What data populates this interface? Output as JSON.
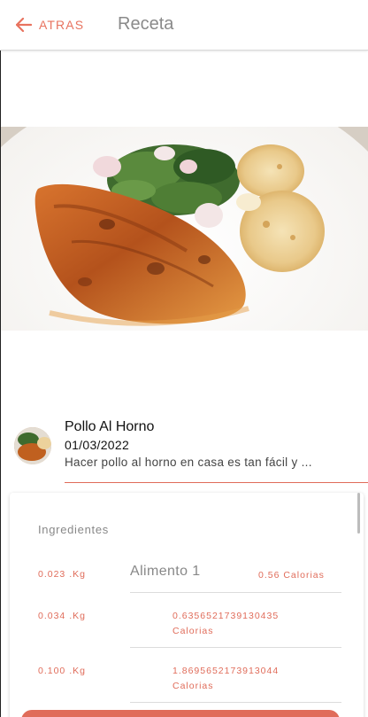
{
  "header": {
    "back_label": "ATRAS",
    "title": "Receta"
  },
  "recipe": {
    "name": "Pollo Al Horno",
    "date": "01/03/2022",
    "description": "Hacer pollo al horno en casa es tan fácil y ..."
  },
  "ingredients": {
    "title": "Ingredientes",
    "items": [
      {
        "quantity": "0.023 .Kg",
        "name": "Alimento 1",
        "calories_line1": "0.56 Calorias",
        "calories_line2": ""
      },
      {
        "quantity": "0.034 .Kg",
        "name": "",
        "calories_line1": "0.6356521739130435",
        "calories_line2": "Calorias"
      },
      {
        "quantity": "0.100 .Kg",
        "name": "",
        "calories_line1": "1.8695652173913044",
        "calories_line2": "Calorias"
      }
    ]
  },
  "colors": {
    "accent": "#e06c5a",
    "title_gray": "#8a8a8a"
  },
  "icons": {
    "back": "arrow-left-icon"
  }
}
